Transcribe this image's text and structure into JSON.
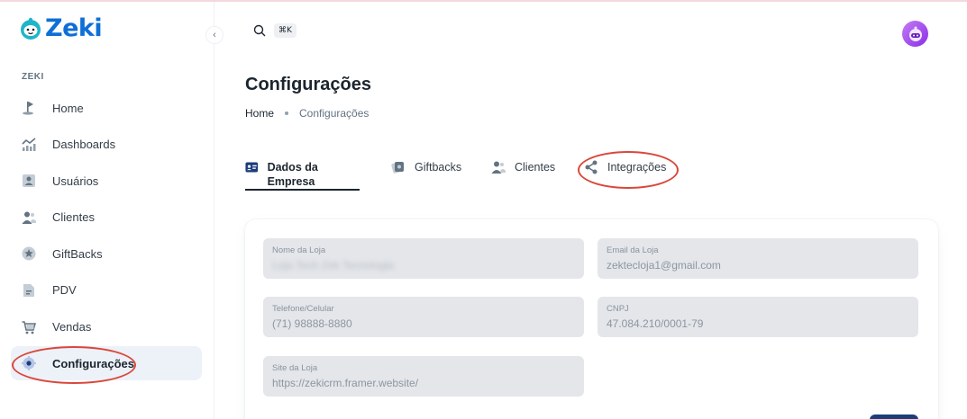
{
  "app": {
    "logo_text": "Zeki",
    "accent": "#0f6fd6"
  },
  "header": {
    "search_shortcut": "⌘K",
    "search_icon": "search-icon"
  },
  "sidebar": {
    "section_label": "ZEKI",
    "items": [
      {
        "label": "Home",
        "icon": "golf-flag-icon",
        "active": false
      },
      {
        "label": "Dashboards",
        "icon": "chart-icon",
        "active": false
      },
      {
        "label": "Usuários",
        "icon": "user-card-icon",
        "active": false
      },
      {
        "label": "Clientes",
        "icon": "users-icon",
        "active": false
      },
      {
        "label": "GiftBacks",
        "icon": "star-icon",
        "active": false
      },
      {
        "label": "PDV",
        "icon": "document-icon",
        "active": false
      },
      {
        "label": "Vendas",
        "icon": "cart-icon",
        "active": false
      },
      {
        "label": "Configurações",
        "icon": "gear-icon",
        "active": true
      }
    ]
  },
  "page": {
    "title": "Configurações",
    "breadcrumb": {
      "home": "Home",
      "current": "Configurações"
    }
  },
  "tabs": [
    {
      "label": "Dados da Empresa",
      "icon": "id-card-icon",
      "active": true
    },
    {
      "label": "Giftbacks",
      "icon": "gift-card-icon",
      "active": false
    },
    {
      "label": "Clientes",
      "icon": "users-icon",
      "active": false
    },
    {
      "label": "Integrações",
      "icon": "share-icon",
      "active": false
    }
  ],
  "form": {
    "store_name": {
      "label": "Nome da Loja",
      "value": "Loja Tech Zek Tecnologia"
    },
    "store_email": {
      "label": "Email da Loja",
      "value": "zektecloja1@gmail.com"
    },
    "phone": {
      "label": "Telefone/Celular",
      "value": "(71) 98888-8880"
    },
    "cnpj": {
      "label": "CNPJ",
      "value": "47.084.210/0001-79"
    },
    "site": {
      "label": "Site da Loja",
      "value": "https://zekicrm.framer.website/"
    }
  },
  "colors": {
    "highlight_circle": "#d9483b",
    "active_nav_bg": "#edf1f8",
    "field_bg": "#e4e6ea"
  }
}
